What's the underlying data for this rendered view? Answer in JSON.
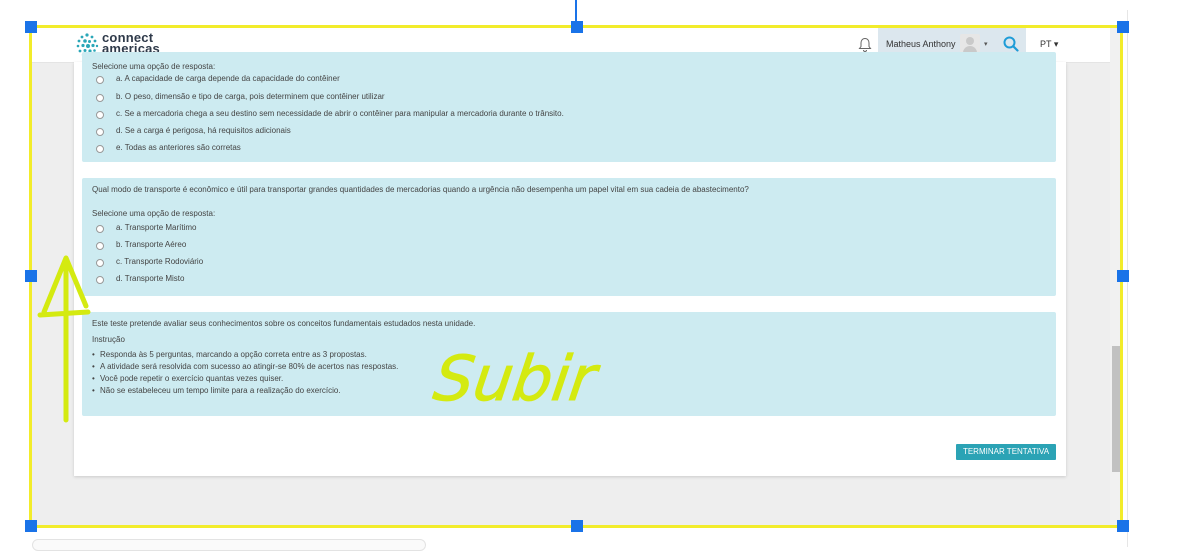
{
  "header": {
    "logo_line1": "connect",
    "logo_line2": "americas",
    "user_name": "Matheus Anthony",
    "user_caret": "▾",
    "language": "PT ▾"
  },
  "question1": {
    "prompt": "Selecione uma opção de resposta:",
    "options": [
      "a. A capacidade de carga depende da capacidade do contêiner",
      "b. O peso, dimensão e tipo de carga, pois determinem que contêiner utilizar",
      "c. Se a mercadoria chega a seu destino sem necessidade de abrir o contêiner para manipular a mercadoria durante o trânsito.",
      "d. Se a carga é perigosa, há requisitos adicionais",
      "e. Todas as anteriores são corretas"
    ]
  },
  "question2": {
    "text": "Qual modo de transporte é econômico e útil para transportar grandes quantidades de mercadorias quando a urgência não desempenha um papel vital em sua cadeia de abastecimento?",
    "prompt": "Selecione uma opção de resposta:",
    "options": [
      "a. Transporte Marítimo",
      "b. Transporte Aéreo",
      "c. Transporte Rodoviário",
      "d. Transporte Misto"
    ]
  },
  "info": {
    "text": "Este teste pretende avaliar seus conhecimentos sobre os conceitos fundamentais estudados nesta unidade.",
    "instruction_label": "Instrução",
    "bullets": [
      "Responda às 5 perguntas, marcando a opção correta entre as 3 propostas.",
      "A atividade será resolvida com sucesso ao atingir-se 80% de acertos nas respostas.",
      "Você pode repetir o exercício quantas vezes quiser.",
      "Não se estabeleceu um tempo limite para a realização do exercício."
    ]
  },
  "finish_button": "TERMINAR TENTATIVA",
  "annotation": {
    "handwritten_text": "Subir",
    "color": "#d4ea10"
  },
  "colors": {
    "selection_frame": "#f2ec2a",
    "handles": "#1a73e8",
    "question_bg": "#cdebf1",
    "accent": "#2ba3b5"
  }
}
